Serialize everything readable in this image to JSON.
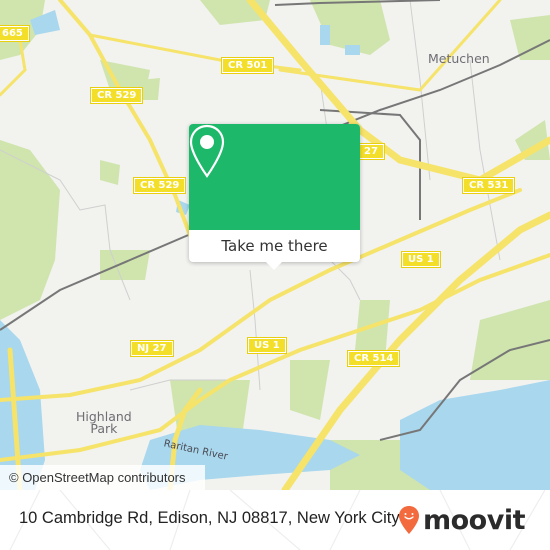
{
  "map": {
    "road_labels": [
      {
        "id": "cr-665",
        "text": "665"
      },
      {
        "id": "cr-501",
        "text": "CR 501"
      },
      {
        "id": "cr-529-a",
        "text": "CR 529"
      },
      {
        "id": "cr-529-b",
        "text": "CR 529"
      },
      {
        "id": "nj-27-a",
        "text": "27"
      },
      {
        "id": "cr-531",
        "text": "CR 531"
      },
      {
        "id": "us-1-a",
        "text": "US 1"
      },
      {
        "id": "us-1-b",
        "text": "US 1"
      },
      {
        "id": "nj-27-b",
        "text": "NJ 27"
      },
      {
        "id": "cr-514",
        "text": "CR 514"
      }
    ],
    "place_labels": {
      "metuchen": "Metuchen",
      "highland_park_line1": "Highland",
      "highland_park_line2": "Park",
      "raritan_river": "Raritan River"
    },
    "attribution": "© OpenStreetMap contributors",
    "colors": {
      "land": "#f2f2ef",
      "park": "#cfe5ad",
      "water": "#a8d7ee",
      "road_major": "#f6e36a",
      "rail": "#777777"
    }
  },
  "popup": {
    "icon": "map-pin-icon",
    "button_label": "Take me there",
    "color": "#1db86a"
  },
  "footer": {
    "address": "10 Cambridge Rd, Edison, NJ 08817, New York City",
    "logo_text": "moovit",
    "logo_icon": "moovit-pin-icon",
    "logo_color": "#f26a3d"
  }
}
